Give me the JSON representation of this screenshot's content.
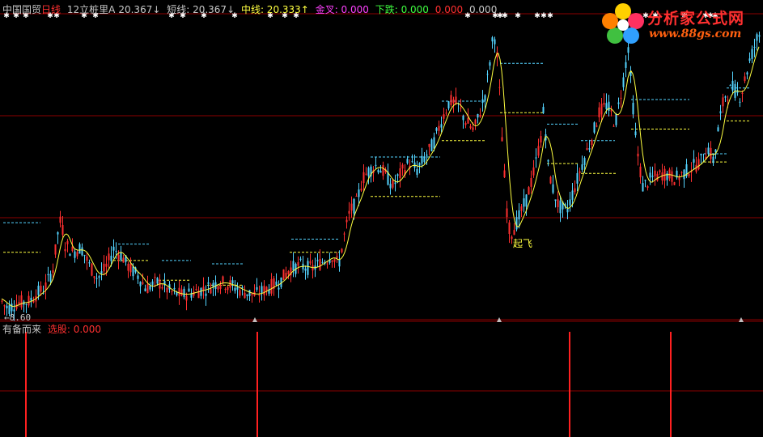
{
  "header": {
    "stock": "中国国贸",
    "period": "日线",
    "indicator": "12立桩里A",
    "v_a": "20.367↓",
    "short_line": "短线: 20.367↓",
    "mid_line": "中线: 20.333↑",
    "golden_cross": "金叉: 0.000",
    "fall": "下跌: 0.000",
    "v_x": "0.000",
    "v_y": "0.000"
  },
  "sub_panel": {
    "name": "有备而来",
    "select": "选股: 0.000"
  },
  "annotations": {
    "low_label": "←8.60",
    "takeoff": "起飞"
  },
  "watermark": {
    "site_name": "分析家公式网",
    "url": "www.88gs.com"
  },
  "colors": {
    "background": "#000000",
    "grid": "#8b0000",
    "up_candle": "#ff3030",
    "down_candle": "#54d4ff",
    "ma_line": "#ffff40",
    "dashed_upper": "#54d4ff",
    "dashed_lower": "#ffff40",
    "signal": "#ff2020",
    "marker": "#c0c0c0"
  },
  "chart_data": {
    "type": "line",
    "title": "",
    "xlabel": "",
    "ylabel": "",
    "main_series": {
      "name": "12立桩里A",
      "price_path": [
        [
          0,
          9.2
        ],
        [
          4,
          8.8
        ],
        [
          10,
          8.6
        ],
        [
          20,
          8.9
        ],
        [
          35,
          9.0
        ],
        [
          48,
          9.6
        ],
        [
          55,
          9.8
        ],
        [
          65,
          11.0
        ],
        [
          72,
          13.5
        ],
        [
          75,
          14.0
        ],
        [
          80,
          12.5
        ],
        [
          90,
          12.0
        ],
        [
          100,
          12.3
        ],
        [
          110,
          11.2
        ],
        [
          120,
          10.4
        ],
        [
          130,
          11.0
        ],
        [
          140,
          12.2
        ],
        [
          150,
          11.8
        ],
        [
          160,
          11.0
        ],
        [
          170,
          10.6
        ],
        [
          180,
          9.8
        ],
        [
          195,
          10.2
        ],
        [
          210,
          9.6
        ],
        [
          225,
          9.4
        ],
        [
          240,
          9.6
        ],
        [
          255,
          9.8
        ],
        [
          270,
          10.2
        ],
        [
          285,
          10.0
        ],
        [
          300,
          9.6
        ],
        [
          315,
          9.4
        ],
        [
          330,
          9.8
        ],
        [
          345,
          10.2
        ],
        [
          358,
          11.0
        ],
        [
          370,
          11.2
        ],
        [
          385,
          11.0
        ],
        [
          400,
          11.5
        ],
        [
          410,
          11.8
        ],
        [
          418,
          11.2
        ],
        [
          425,
          13.0
        ],
        [
          432,
          14.5
        ],
        [
          440,
          15.0
        ],
        [
          448,
          16.5
        ],
        [
          456,
          17.0
        ],
        [
          465,
          17.3
        ],
        [
          475,
          16.8
        ],
        [
          485,
          16.0
        ],
        [
          495,
          16.8
        ],
        [
          505,
          17.5
        ],
        [
          515,
          17.0
        ],
        [
          525,
          17.8
        ],
        [
          535,
          18.6
        ],
        [
          545,
          20.0
        ],
        [
          555,
          21.2
        ],
        [
          565,
          21.0
        ],
        [
          575,
          20.0
        ],
        [
          585,
          19.4
        ],
        [
          592,
          20.4
        ],
        [
          600,
          21.8
        ],
        [
          605,
          23.6
        ],
        [
          610,
          25.5
        ],
        [
          615,
          23.5
        ],
        [
          620,
          19.0
        ],
        [
          625,
          15.0
        ],
        [
          630,
          13.0
        ],
        [
          640,
          14.0
        ],
        [
          650,
          15.2
        ],
        [
          660,
          17.0
        ],
        [
          668,
          19.0
        ],
        [
          672,
          21.0
        ],
        [
          676,
          17.5
        ],
        [
          682,
          16.0
        ],
        [
          690,
          14.8
        ],
        [
          700,
          14.5
        ],
        [
          710,
          16.0
        ],
        [
          720,
          17.5
        ],
        [
          730,
          18.8
        ],
        [
          740,
          20.5
        ],
        [
          750,
          21.0
        ],
        [
          760,
          19.8
        ],
        [
          770,
          22.5
        ],
        [
          776,
          24.5
        ],
        [
          780,
          22.0
        ],
        [
          786,
          18.5
        ],
        [
          794,
          16.0
        ],
        [
          805,
          16.5
        ],
        [
          820,
          16.8
        ],
        [
          835,
          16.5
        ],
        [
          850,
          17.0
        ],
        [
          865,
          17.5
        ],
        [
          875,
          18.3
        ],
        [
          882,
          17.5
        ],
        [
          888,
          19.8
        ],
        [
          895,
          21.5
        ],
        [
          905,
          22.0
        ],
        [
          915,
          21.5
        ],
        [
          925,
          23.5
        ],
        [
          935,
          25.0
        ],
        [
          943,
          25.6
        ]
      ]
    },
    "level_lines": [
      {
        "upper": [
          4,
          50,
          13.8
        ],
        "lower": [
          4,
          50,
          12.0
        ]
      },
      {
        "upper": [
          146,
          186,
          12.5
        ],
        "lower": [
          140,
          185,
          11.5
        ]
      },
      {
        "upper": [
          200,
          236,
          11.5
        ],
        "lower": [
          196,
          236,
          10.3
        ]
      },
      {
        "upper": [
          262,
          300,
          11.3
        ],
        "lower": [
          256,
          300,
          10.0
        ]
      },
      {
        "upper": [
          360,
          418,
          12.8
        ],
        "lower": [
          358,
          420,
          12.0
        ]
      },
      {
        "upper": [
          458,
          544,
          17.8
        ],
        "lower": [
          458,
          544,
          15.4
        ]
      },
      {
        "upper": [
          546,
          600,
          21.2
        ],
        "lower": [
          546,
          600,
          18.8
        ]
      },
      {
        "upper": [
          618,
          672,
          23.5
        ],
        "lower": [
          618,
          672,
          20.5
        ]
      },
      {
        "upper": [
          676,
          714,
          19.8
        ],
        "lower": [
          676,
          714,
          17.4
        ]
      },
      {
        "upper": [
          718,
          760,
          18.8
        ],
        "lower": [
          718,
          762,
          16.8
        ]
      },
      {
        "upper": [
          780,
          852,
          21.3
        ],
        "lower": [
          780,
          852,
          19.5
        ]
      },
      {
        "upper": [
          870,
          898,
          18.0
        ],
        "lower": [
          870,
          898,
          17.5
        ]
      },
      {
        "upper": [
          898,
          926,
          22.0
        ],
        "lower": [
          898,
          926,
          20.0
        ]
      }
    ],
    "select_signals_x": [
      32,
      318,
      704,
      829
    ],
    "bottom_markers_x": [
      315,
      617,
      916
    ],
    "top_star_groups": [
      {
        "x": [
          8,
          20,
          32
        ]
      },
      {
        "x": [
          62,
          70
        ]
      },
      {
        "x": [
          104,
          118
        ]
      },
      {
        "x": [
          212,
          226
        ]
      },
      {
        "x": [
          252
        ]
      },
      {
        "x": [
          290
        ]
      },
      {
        "x": [
          334
        ]
      },
      {
        "x": [
          352,
          366
        ]
      },
      {
        "x": [
          578
        ]
      },
      {
        "x": [
          612,
          618,
          624,
          640
        ]
      },
      {
        "x": [
          664,
          672,
          680
        ]
      },
      {
        "x": [
          764,
          776
        ]
      },
      {
        "x": [
          798,
          810
        ]
      },
      {
        "x": [
          846
        ]
      },
      {
        "x": [
          872,
          878,
          884
        ]
      }
    ]
  }
}
